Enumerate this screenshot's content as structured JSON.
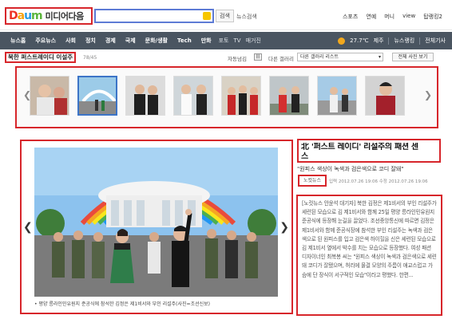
{
  "header": {
    "logo_text": "Daum",
    "logo_title": "미디어다음",
    "search_placeholder": "",
    "search_button": "검색",
    "news_search_link": "뉴스검색",
    "top_links": [
      "스포츠",
      "연예",
      "머니",
      "view",
      "탑랭킹2"
    ]
  },
  "nav": {
    "items": [
      "뉴스홈",
      "주요뉴스",
      "사회",
      "정치",
      "경제",
      "국제",
      "문화/생활",
      "Tech",
      "만화"
    ],
    "small_items": [
      "포토",
      "TV",
      "매거진"
    ],
    "weather_temp": "27.7℃",
    "weather_city": "제주",
    "link_news": "뉴스랭킹",
    "link_all": "전체기사"
  },
  "gallery": {
    "title": "북한 퍼스트레이디 이설주",
    "count": "78/45",
    "autoplay_label": "자동넘김",
    "autoplay_button": "|||",
    "next_gallery_label": "다른 갤러리",
    "select_value": "다른 갤러리 리스트",
    "view_all_button": "전체 사진 보기",
    "prev_icon": "chevron-left-icon",
    "next_icon": "chevron-right-icon"
  },
  "photo": {
    "caption": "• 평양 릉라인민유원지 준공식에 참석한 김정은 제1비서와 부인 리설주(사진=조선신보)"
  },
  "article": {
    "title_line1": "北 '퍼스트 레이디' 리설주의 패션 센",
    "title_line2": "스",
    "subtitle": "\"원피스 색상이 녹색과 검은색으로 코디 잘돼\"",
    "source": "노컷뉴스",
    "date": "입력 2012.07.26 19:06   수정 2012.07.26 19:06",
    "body": "[노컷뉴스 안윤석 대기자] 북한 김정은 제1비서의 부인 리설주가 세련된 모습으로 김 제1비서와 함께 25일 평양 릉라인민유원지 준공식에 등장해 눈길을 끌었다. 조선중앙통신에 따르면 김정은 제1비서와 함께 준공식장에 참석한 부인 리설주는 녹색과 검은색으로 된 원피스를 입고 검은색 하이힐을 신은 세련된 모습으로 김 제1비서 옆에서 박수를 치는 모습으로 등장했다. 여성 패션 디자이너인 최복봉 씨는 \"원피스 색상이 녹색과 검은색으로 세련돼 코디가 잘됐으며, 허리에 물결 모양의 주름이 애교스럽고 가슴에 단 장식이 서구적인 모습\"이라고 평했다. 한편..."
  }
}
